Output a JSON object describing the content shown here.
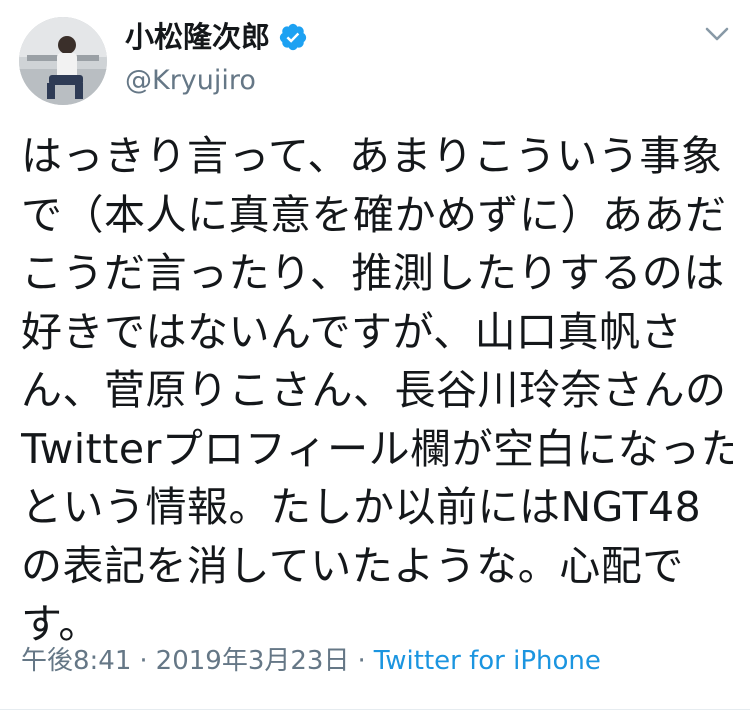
{
  "tweet": {
    "author": {
      "display_name": "小松隆次郎",
      "handle": "@Kryujiro",
      "verified": true
    },
    "text_lines": [
      "はっきり言って、あまりこういう事象",
      "で（本人に真意を確かめずに）ああだ",
      "こうだ言ったり、推測したりするのは",
      "好きではないんですが、山口真帆さ",
      "ん、菅原りこさん、長谷川玲奈さんの",
      "Twitterプロフィール欄が空白になった",
      "という情報。たしか以前にはNGT48",
      "の表記を消していたような。心配で",
      "す。"
    ],
    "meta": {
      "time": "午後8:41",
      "separator": "·",
      "date": "2019年3月23日",
      "source": "Twitter for iPhone"
    }
  },
  "colors": {
    "text": "#14171a",
    "secondary": "#657786",
    "link": "#1b95e0",
    "verified": "#1da1f2",
    "divider": "#e6ecf0"
  },
  "icons": {
    "verified": "verified-badge-icon",
    "menu": "chevron-down-icon"
  }
}
